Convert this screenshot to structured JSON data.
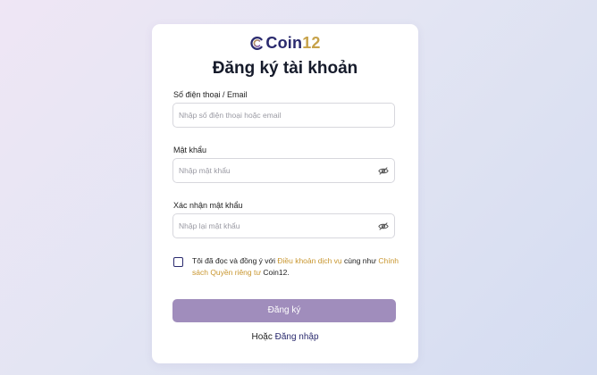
{
  "brand": {
    "name_word": "Coin",
    "name_number": "12",
    "colors": {
      "primary": "#2a2a6e",
      "gold": "#c7a24a",
      "button": "#a08dbc"
    }
  },
  "page": {
    "title": "Đăng ký tài khoản"
  },
  "form": {
    "phone_label": "Số điện thoại / Email",
    "phone_placeholder": "Nhập số điện thoại hoặc email",
    "password_label": "Mật khẩu",
    "password_placeholder": "Nhập mật khẩu",
    "confirm_label": "Xác nhận mật khẩu",
    "confirm_placeholder": "Nhập lại mật khẩu",
    "eye_icon": "eye-slash-icon"
  },
  "agreement": {
    "checked": false,
    "prefix": "Tôi đã đọc và đồng ý với ",
    "terms_link": "Điều khoản dịch vụ",
    "middle": " cùng như ",
    "privacy_link": "Chính sách Quyền riêng tư",
    "suffix": " Coin12."
  },
  "submit_label": "Đăng ký",
  "alt": {
    "prefix": "Hoặc ",
    "login_link": "Đăng nhập"
  }
}
